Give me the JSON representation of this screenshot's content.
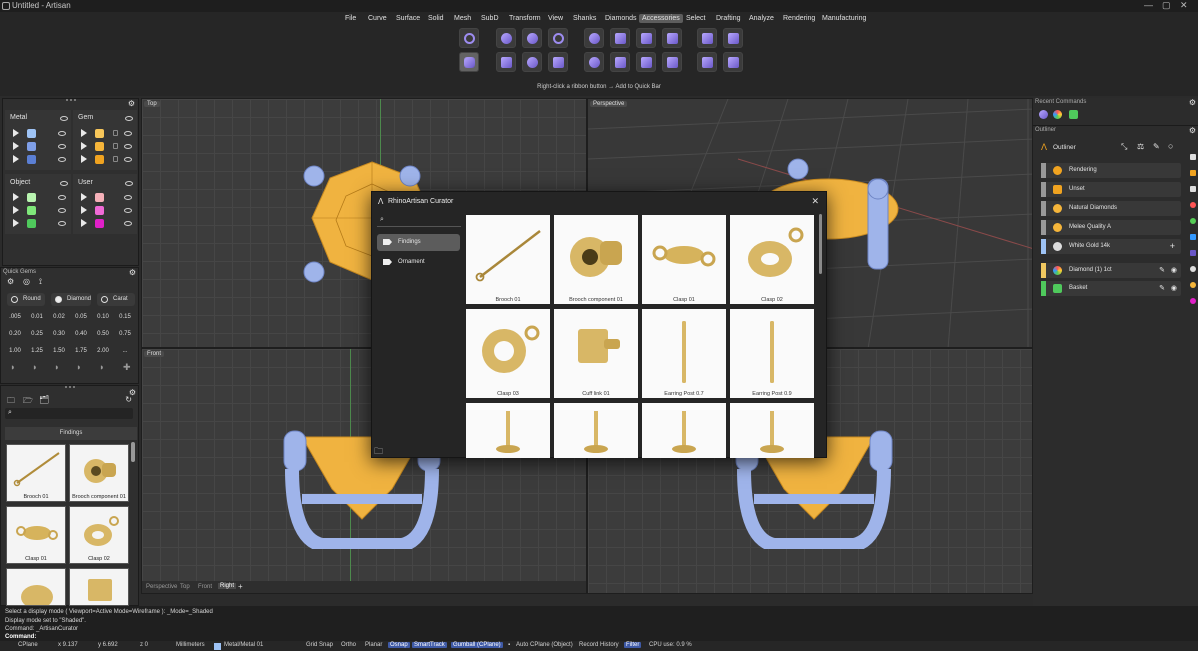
{
  "app": {
    "title": "Untitled - Artisan"
  },
  "menu": [
    "File",
    "Curve",
    "Surface",
    "Solid",
    "Mesh",
    "SubD",
    "Transform",
    "View",
    "Shanks",
    "Diamonds",
    "Accessories",
    "Select",
    "Drafting",
    "Analyze",
    "Rendering",
    "Manufacturing"
  ],
  "menu_active": "Accessories",
  "ribbon": {
    "hint": "Right-click a ribbon button → Add to Quick Bar"
  },
  "layers": {
    "metal": {
      "label": "Metal",
      "colors": [
        "#9ec3f5",
        "#7f9fe8",
        "#5b7fd4"
      ]
    },
    "gem": {
      "label": "Gem",
      "colors": [
        "#f7c65a",
        "#f5b53a",
        "#f0a320"
      ]
    },
    "object": {
      "label": "Object",
      "colors": [
        "#b9f5b0",
        "#7fe87a",
        "#4fc95c"
      ]
    },
    "user": {
      "label": "User",
      "colors": [
        "#f5b0b8",
        "#f06ad6",
        "#e020c8"
      ]
    }
  },
  "quick_gems": {
    "title": "Quick Gems",
    "buttons": [
      "Round",
      "Diamond",
      "Carat"
    ],
    "sizes": [
      ".005",
      "0.01",
      "0.02",
      "0.05",
      "0.10",
      "0.15",
      "0.20",
      "0.25",
      "0.30",
      "0.40",
      "0.50",
      "0.75",
      "1.00",
      "1.25",
      "1.50",
      "1.75",
      "2.00",
      "..."
    ]
  },
  "findings_panel": {
    "title": "Findings",
    "items": [
      "Brooch 01",
      "Brooch component 01",
      "Clasp 01",
      "Clasp 02"
    ]
  },
  "viewports": {
    "top": "Top",
    "perspective": "Perspective",
    "front": "Front",
    "right": "Right"
  },
  "viewport_tabs": [
    "Perspective",
    "Top",
    "Front",
    "Right"
  ],
  "curator": {
    "title": "RhinoArtisan Curator",
    "categories": [
      "Findings",
      "Ornament"
    ],
    "items": [
      "Brooch 01",
      "Brooch component 01",
      "Clasp 01",
      "Clasp 02",
      "Clasp 03",
      "Cuff link 01",
      "Earring Post 0.7",
      "Earring Post 0.9"
    ]
  },
  "right": {
    "recent_title": "Recent Commands",
    "outliner_title": "Outliner",
    "outliner_header": "Outliner",
    "rows": [
      "Rendering",
      "Unset",
      "Natural Diamonds",
      "Melee Quality A",
      "White Gold 14k"
    ],
    "objects": [
      "Diamond (1) 1ct",
      "Basket"
    ]
  },
  "command": {
    "lines": [
      "Select a display mode ( Viewport=Active  Mode=Wireframe ): _Mode=_Shaded",
      "Display mode set to \"Shaded\".",
      "Command: _ArtisanCurator"
    ],
    "prompt": "Command:"
  },
  "status": {
    "cplane": "CPlane",
    "x": "x 9.137",
    "y": "y 6.692",
    "z": "z 0",
    "units": "Millimeters",
    "layer": "Metal/Metal 01",
    "toggles": [
      "Grid Snap",
      "Ortho",
      "Planar",
      "Osnap",
      "SmartTrack",
      "Gumball (CPlane)",
      "Auto CPlane (Object)",
      "Record History",
      "Filter"
    ],
    "cpu": "CPU use: 0.9 %"
  }
}
